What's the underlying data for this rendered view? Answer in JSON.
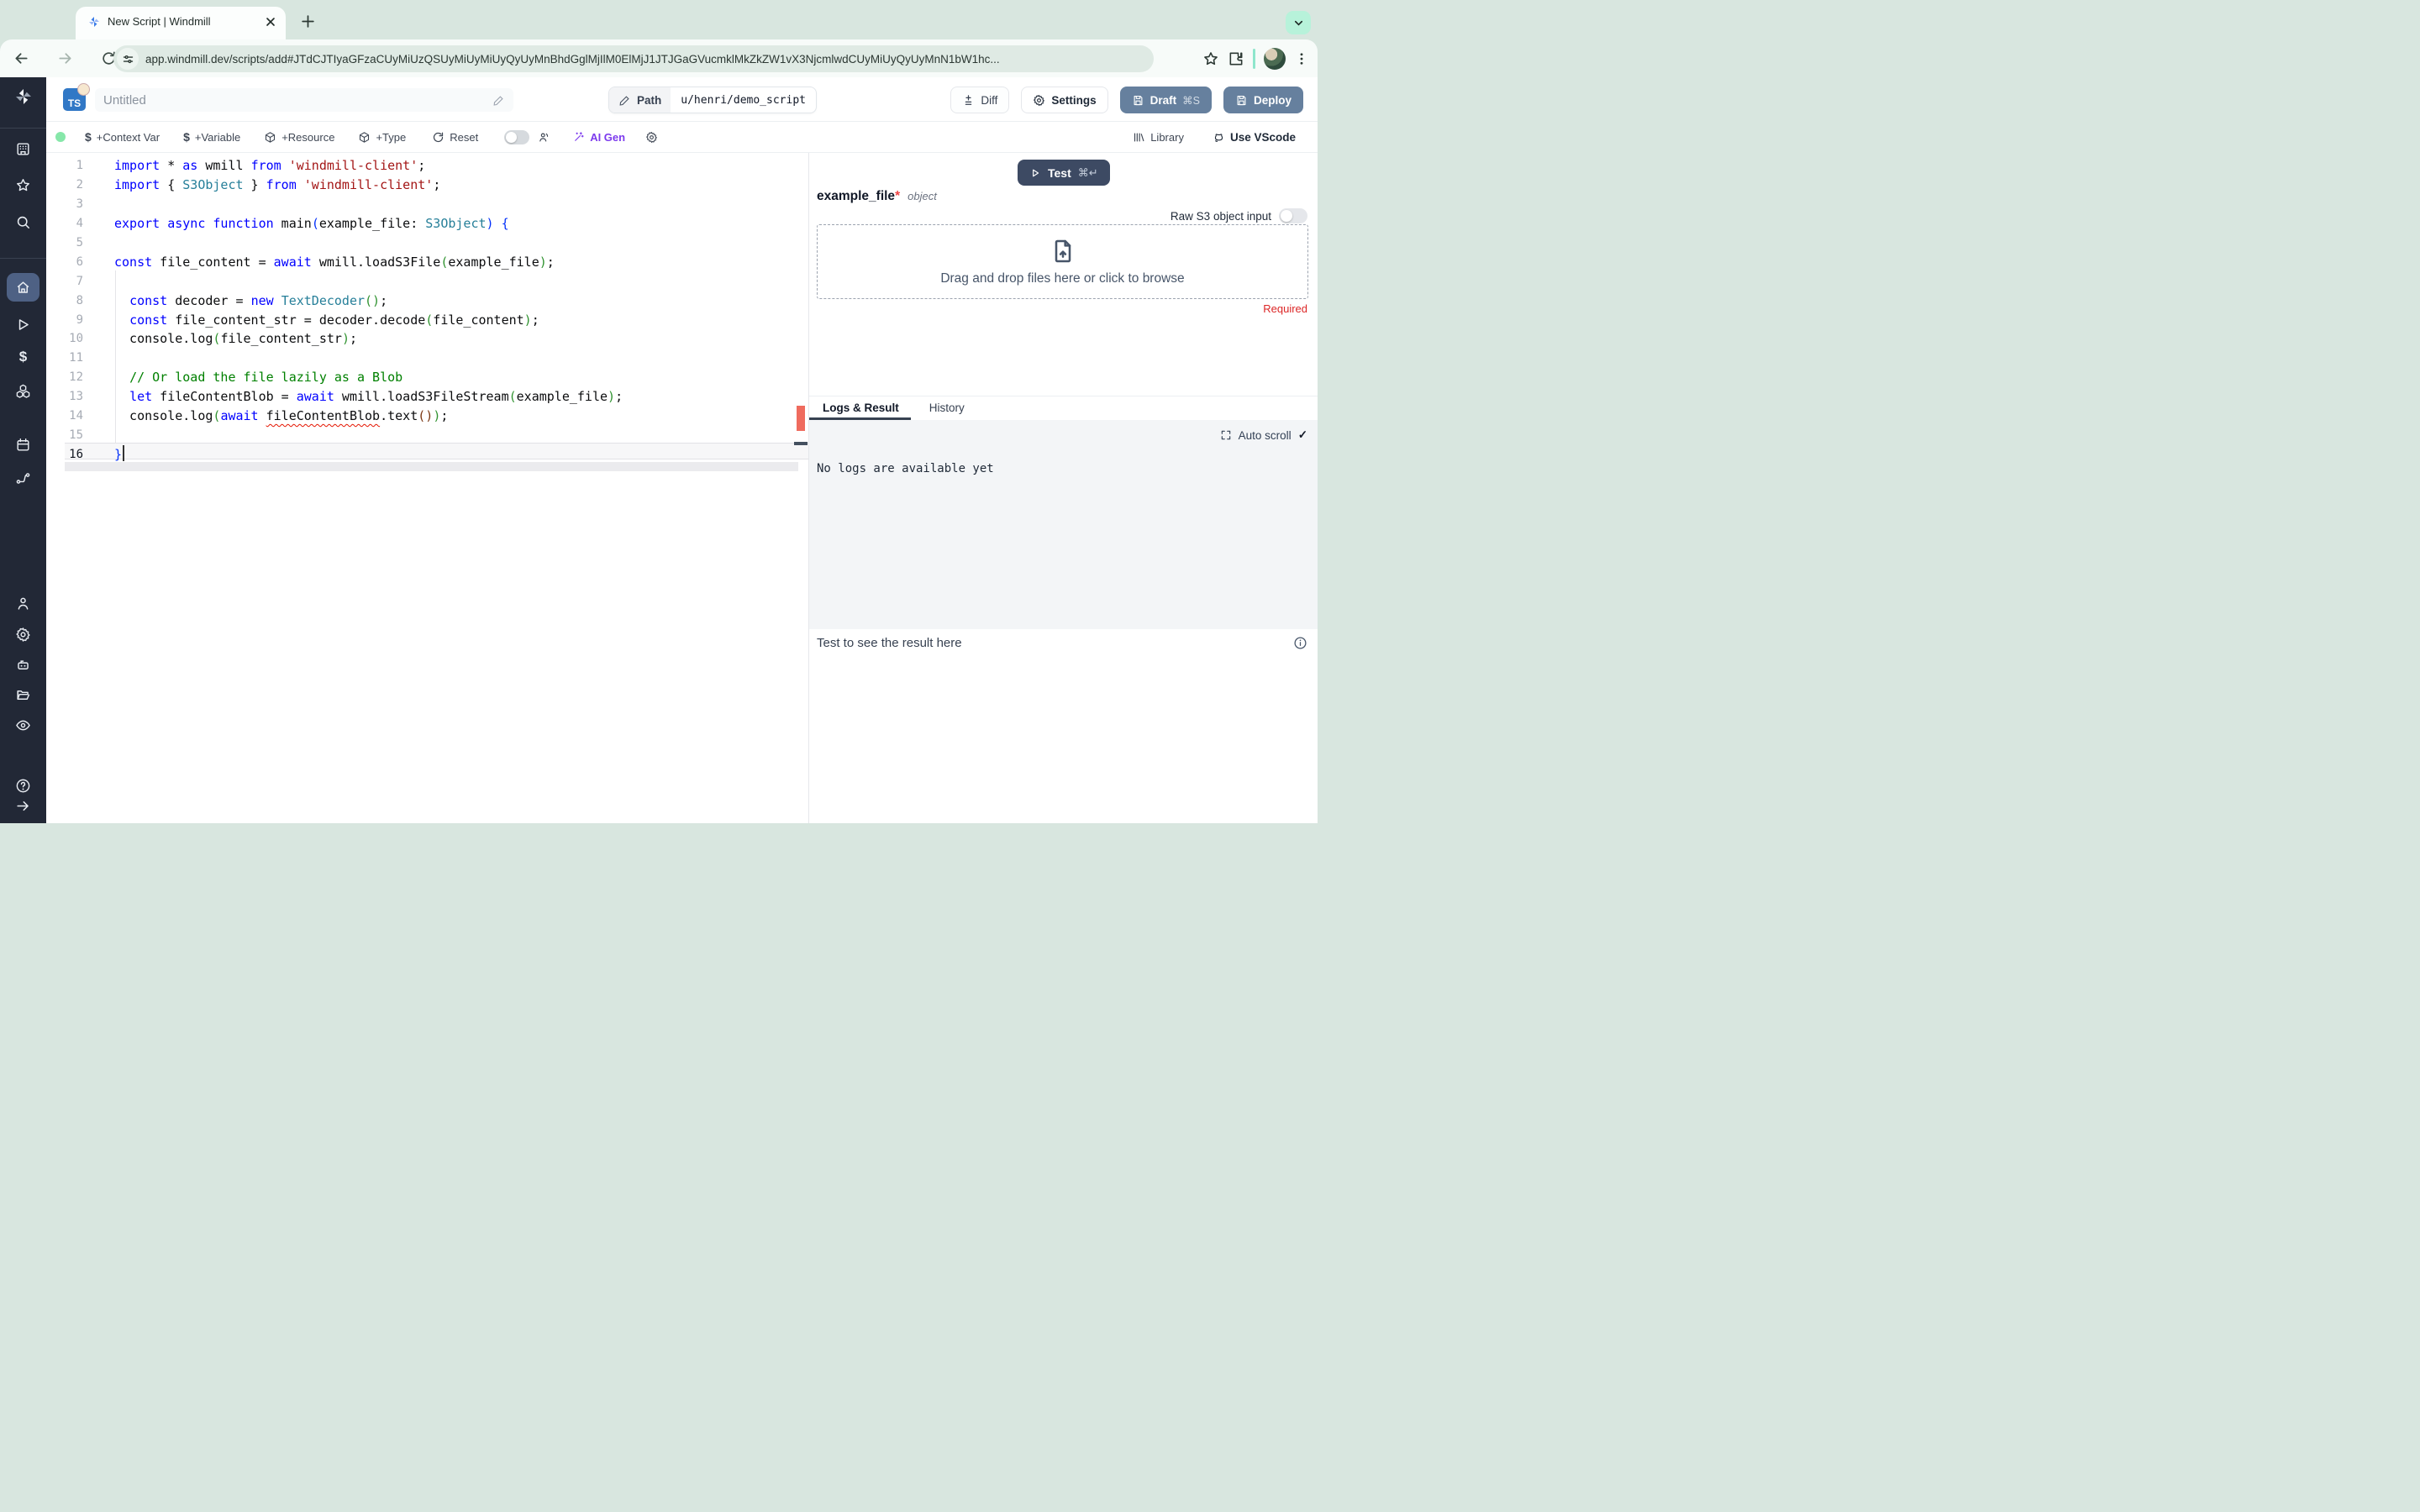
{
  "browser": {
    "tab_title": "New Script | Windmill",
    "url": "app.windmill.dev/scripts/add#JTdCJTIyaGFzaCUyMiUzQSUyMiUyMiUyQyUyMnBhdGglMjIlM0ElMjJ1JTJGaGVucmklMkZkZW1vX3NjcmlwdCUyMiUyQyUyMnN1bW1hc...",
    "icons": [
      "back-icon",
      "forward-icon",
      "reload-icon",
      "site-settings-icon",
      "bookmark-star-icon",
      "extensions-puzzle-icon",
      "profile-avatar",
      "menu-dots-icon",
      "chevron-down-icon",
      "new-tab-plus-icon",
      "close-tab-icon",
      "windmill-favicon"
    ]
  },
  "sidebar": {
    "items": [
      "windmill-logo",
      "workspace",
      "favorites",
      "search",
      "home",
      "runs",
      "variables",
      "resources",
      "schedules",
      "flows",
      "user",
      "settings",
      "workers",
      "folders",
      "audit-logs",
      "help",
      "collapse"
    ]
  },
  "header": {
    "lang_badge": "TS",
    "title_placeholder": "Untitled",
    "path_label": "Path",
    "path_value": "u/henri/demo_script",
    "diff_label": "Diff",
    "settings_label": "Settings",
    "draft_label": "Draft",
    "draft_shortcut": "⌘S",
    "deploy_label": "Deploy"
  },
  "toolbar": {
    "context_var": "+Context Var",
    "variable": "+Variable",
    "resource": "+Resource",
    "type": "+Type",
    "reset": "Reset",
    "ai_gen": "AI Gen",
    "library": "Library",
    "vscode": "Use VScode"
  },
  "editor": {
    "language": "typescript",
    "active_line": 16,
    "lines": [
      [
        [
          "k",
          "import"
        ],
        [
          "d",
          " * "
        ],
        [
          "k",
          "as"
        ],
        [
          "d",
          " wmill "
        ],
        [
          "k",
          "from"
        ],
        [
          "d",
          " "
        ],
        [
          "s",
          "'windmill-client'"
        ],
        [
          "d",
          ";"
        ]
      ],
      [
        [
          "k",
          "import"
        ],
        [
          "d",
          " { "
        ],
        [
          "t",
          "S3Object"
        ],
        [
          "d",
          " } "
        ],
        [
          "k",
          "from"
        ],
        [
          "d",
          " "
        ],
        [
          "s",
          "'windmill-client'"
        ],
        [
          "d",
          ";"
        ]
      ],
      [],
      [
        [
          "k",
          "export"
        ],
        [
          "d",
          " "
        ],
        [
          "k",
          "async"
        ],
        [
          "d",
          " "
        ],
        [
          "k",
          "function"
        ],
        [
          "d",
          " main"
        ],
        [
          "b1",
          "("
        ],
        [
          "d",
          "example_file: "
        ],
        [
          "t",
          "S3Object"
        ],
        [
          "b1",
          ")"
        ],
        [
          "d",
          " "
        ],
        [
          "b1",
          "{"
        ]
      ],
      [],
      [
        [
          "k",
          "const"
        ],
        [
          "d",
          " file_content = "
        ],
        [
          "k",
          "await"
        ],
        [
          "d",
          " wmill.loadS3File"
        ],
        [
          "b2",
          "("
        ],
        [
          "d",
          "example_file"
        ],
        [
          "b2",
          ")"
        ],
        [
          "d",
          ";"
        ]
      ],
      [],
      [
        [
          "d",
          "  "
        ],
        [
          "k",
          "const"
        ],
        [
          "d",
          " decoder = "
        ],
        [
          "k",
          "new"
        ],
        [
          "d",
          " "
        ],
        [
          "t",
          "TextDecoder"
        ],
        [
          "b2",
          "()"
        ],
        [
          "d",
          ";"
        ]
      ],
      [
        [
          "d",
          "  "
        ],
        [
          "k",
          "const"
        ],
        [
          "d",
          " file_content_str = decoder.decode"
        ],
        [
          "b2",
          "("
        ],
        [
          "d",
          "file_content"
        ],
        [
          "b2",
          ")"
        ],
        [
          "d",
          ";"
        ]
      ],
      [
        [
          "d",
          "  console.log"
        ],
        [
          "b2",
          "("
        ],
        [
          "d",
          "file_content_str"
        ],
        [
          "b2",
          ")"
        ],
        [
          "d",
          ";"
        ]
      ],
      [],
      [
        [
          "d",
          "  "
        ],
        [
          "c",
          "// Or load the file lazily as a Blob"
        ]
      ],
      [
        [
          "d",
          "  "
        ],
        [
          "k",
          "let"
        ],
        [
          "d",
          " fileContentBlob = "
        ],
        [
          "k",
          "await"
        ],
        [
          "d",
          " wmill.loadS3FileStream"
        ],
        [
          "b2",
          "("
        ],
        [
          "d",
          "example_file"
        ],
        [
          "b2",
          ")"
        ],
        [
          "d",
          ";"
        ]
      ],
      [
        [
          "d",
          "  console.log"
        ],
        [
          "b2",
          "("
        ],
        [
          "k",
          "await"
        ],
        [
          "d",
          " "
        ],
        [
          "e",
          "fileContentBlob"
        ],
        [
          "d",
          ".text"
        ],
        [
          "b3",
          "()"
        ],
        [
          "b2",
          ")"
        ],
        [
          "d",
          ";"
        ]
      ],
      [],
      [
        [
          "b1",
          "}"
        ]
      ]
    ]
  },
  "right_panel": {
    "test_label": "Test",
    "test_shortcut": "⌘↵",
    "arg_name": "example_file",
    "arg_required_mark": "*",
    "arg_type": "object",
    "raw_s3_label": "Raw S3 object input",
    "dropzone_text": "Drag and drop files here or click to browse",
    "required_label": "Required",
    "tab_logs": "Logs & Result",
    "tab_history": "History",
    "auto_scroll_label": "Auto scroll",
    "auto_scroll_check": "✓",
    "no_logs_text": "No logs are available yet",
    "result_placeholder": "Test to see the result here"
  },
  "colors": {
    "accent_slate": "#66809e",
    "test_button": "#3d4a63",
    "sidebar_bg": "#222836",
    "sidebar_active": "#4e6184",
    "ai_violet": "#7c3aed",
    "error_red": "#e51400",
    "required_red": "#dc2626",
    "chrome_mint": "#b7f2da"
  }
}
